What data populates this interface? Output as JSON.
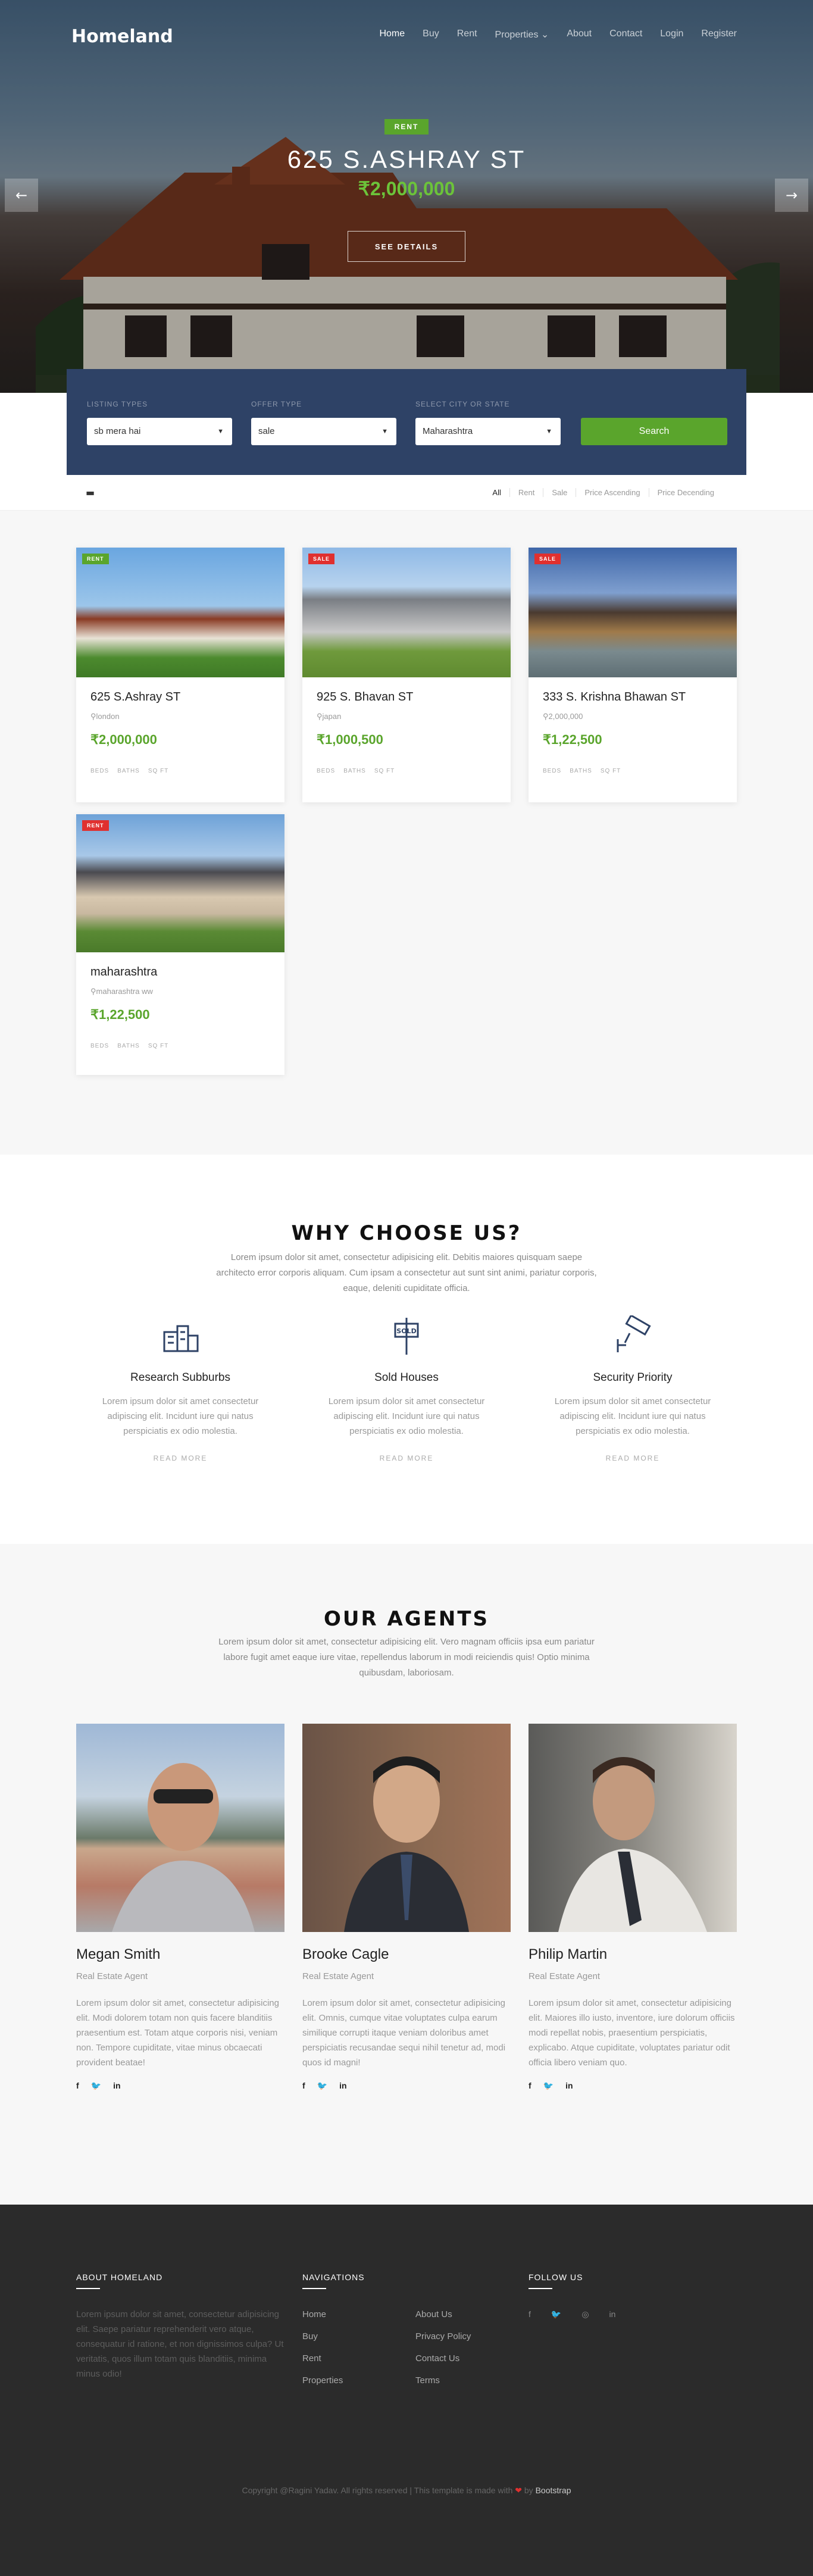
{
  "brand": {
    "name": "Homeland"
  },
  "nav": {
    "items": [
      {
        "label": "Home",
        "active": true
      },
      {
        "label": "Buy",
        "active": false
      },
      {
        "label": "Rent",
        "active": false
      },
      {
        "label": "Properties ⌄",
        "active": false
      },
      {
        "label": "About",
        "active": false
      },
      {
        "label": "Contact",
        "active": false
      },
      {
        "label": "Login",
        "active": false
      },
      {
        "label": "Register",
        "active": false
      }
    ]
  },
  "hero": {
    "badge": "RENT",
    "title": "625 S.ASHRAY ST",
    "price": "₹2,000,000",
    "button": "SEE DETAILS",
    "prev_icon": "arrow-left-icon",
    "next_icon": "arrow-right-icon"
  },
  "search": {
    "listing_label": "LISTING TYPES",
    "listing_value": "sb mera hai",
    "offer_label": "OFFER TYPE",
    "offer_value": "sale",
    "city_label": "SELECT CITY OR STATE",
    "city_value": "Maharashtra",
    "button": "Search"
  },
  "filters": {
    "items": [
      "All",
      "Rent",
      "Sale",
      "Price Ascending",
      "Price Decending"
    ],
    "active": "All"
  },
  "listings": [
    {
      "tag": "RENT",
      "tag_color": "#5aa52c",
      "title": "625 S.Ashray ST",
      "location": "london",
      "price": "₹2,000,000",
      "meta": [
        "BEDS",
        "BATHS",
        "SQ FT"
      ]
    },
    {
      "tag": "SALE",
      "tag_color": "#e0302f",
      "title": "925 S. Bhavan ST",
      "location": "japan",
      "price": "₹1,000,500",
      "meta": [
        "BEDS",
        "BATHS",
        "SQ FT"
      ]
    },
    {
      "tag": "SALE",
      "tag_color": "#e0302f",
      "title": "333 S. Krishna Bhawan ST",
      "location": "2,000,000",
      "price": "₹1,22,500",
      "meta": [
        "BEDS",
        "BATHS",
        "SQ FT"
      ]
    },
    {
      "tag": "RENT",
      "tag_color": "#e0302f",
      "title": "maharashtra",
      "location": "maharashtra ww",
      "price": "₹1,22,500",
      "meta": [
        "BEDS",
        "BATHS",
        "SQ FT"
      ]
    }
  ],
  "why": {
    "title": "WHY CHOOSE US?",
    "desc": "Lorem ipsum dolor sit amet, consectetur adipisicing elit. Debitis maiores quisquam saepe architecto error corporis aliquam. Cum ipsam a consectetur aut sunt sint animi, pariatur corporis, eaque, deleniti cupiditate officia.",
    "features": [
      {
        "icon": "buildings-icon",
        "title": "Research Subburbs",
        "text": "Lorem ipsum dolor sit amet consectetur adipiscing elit. Incidunt iure qui natus perspiciatis ex odio molestia.",
        "link": "READ MORE"
      },
      {
        "icon": "sold-sign-icon",
        "title": "Sold Houses",
        "text": "Lorem ipsum dolor sit amet consectetur adipiscing elit. Incidunt iure qui natus perspiciatis ex odio molestia.",
        "link": "READ MORE"
      },
      {
        "icon": "security-camera-icon",
        "title": "Security Priority",
        "text": "Lorem ipsum dolor sit amet consectetur adipiscing elit. Incidunt iure qui natus perspiciatis ex odio molestia.",
        "link": "READ MORE"
      }
    ]
  },
  "agents": {
    "title": "OUR AGENTS",
    "desc": "Lorem ipsum dolor sit amet, consectetur adipisicing elit. Vero magnam officiis ipsa eum pariatur labore fugit amet eaque iure vitae, repellendus laborum in modi reiciendis quis! Optio minima quibusdam, laboriosam.",
    "people": [
      {
        "name": "Megan Smith",
        "role": "Real Estate Agent",
        "bio": "Lorem ipsum dolor sit amet, consectetur adipisicing elit. Modi dolorem totam non quis facere blanditiis praesentium est. Totam atque corporis nisi, veniam non. Tempore cupiditate, vitae minus obcaecati provident beatae!"
      },
      {
        "name": "Brooke Cagle",
        "role": "Real Estate Agent",
        "bio": "Lorem ipsum dolor sit amet, consectetur adipisicing elit. Omnis, cumque vitae voluptates culpa earum similique corrupti itaque veniam doloribus amet perspiciatis recusandae sequi nihil tenetur ad, modi quos id magni!"
      },
      {
        "name": "Philip Martin",
        "role": "Real Estate Agent",
        "bio": "Lorem ipsum dolor sit amet, consectetur adipisicing elit. Maiores illo iusto, inventore, iure dolorum officiis modi repellat nobis, praesentium perspiciatis, explicabo. Atque cupiditate, voluptates pariatur odit officia libero veniam quo."
      }
    ],
    "social": [
      "f",
      "🐦",
      "in"
    ]
  },
  "footer": {
    "about_title": "ABOUT HOMELAND",
    "about_text": "Lorem ipsum dolor sit amet, consectetur adipisicing elit. Saepe pariatur reprehenderit vero atque, consequatur id ratione, et non dignissimos culpa? Ut veritatis, quos illum totam quis blanditiis, minima minus odio!",
    "nav_title": "NAVIGATIONS",
    "nav_col1": [
      "Home",
      "Buy",
      "Rent",
      "Properties"
    ],
    "nav_col2": [
      "About Us",
      "Privacy Policy",
      "Contact Us",
      "Terms"
    ],
    "follow_title": "FOLLOW US",
    "follow": [
      "f",
      "🐦",
      "◎",
      "in"
    ],
    "copyright_pre": "Copyright @Ragini Yadav. All rights reserved | This template is made with",
    "copyright_heart": "❤",
    "copyright_by": "by",
    "copyright_brand": "Bootstrap"
  }
}
